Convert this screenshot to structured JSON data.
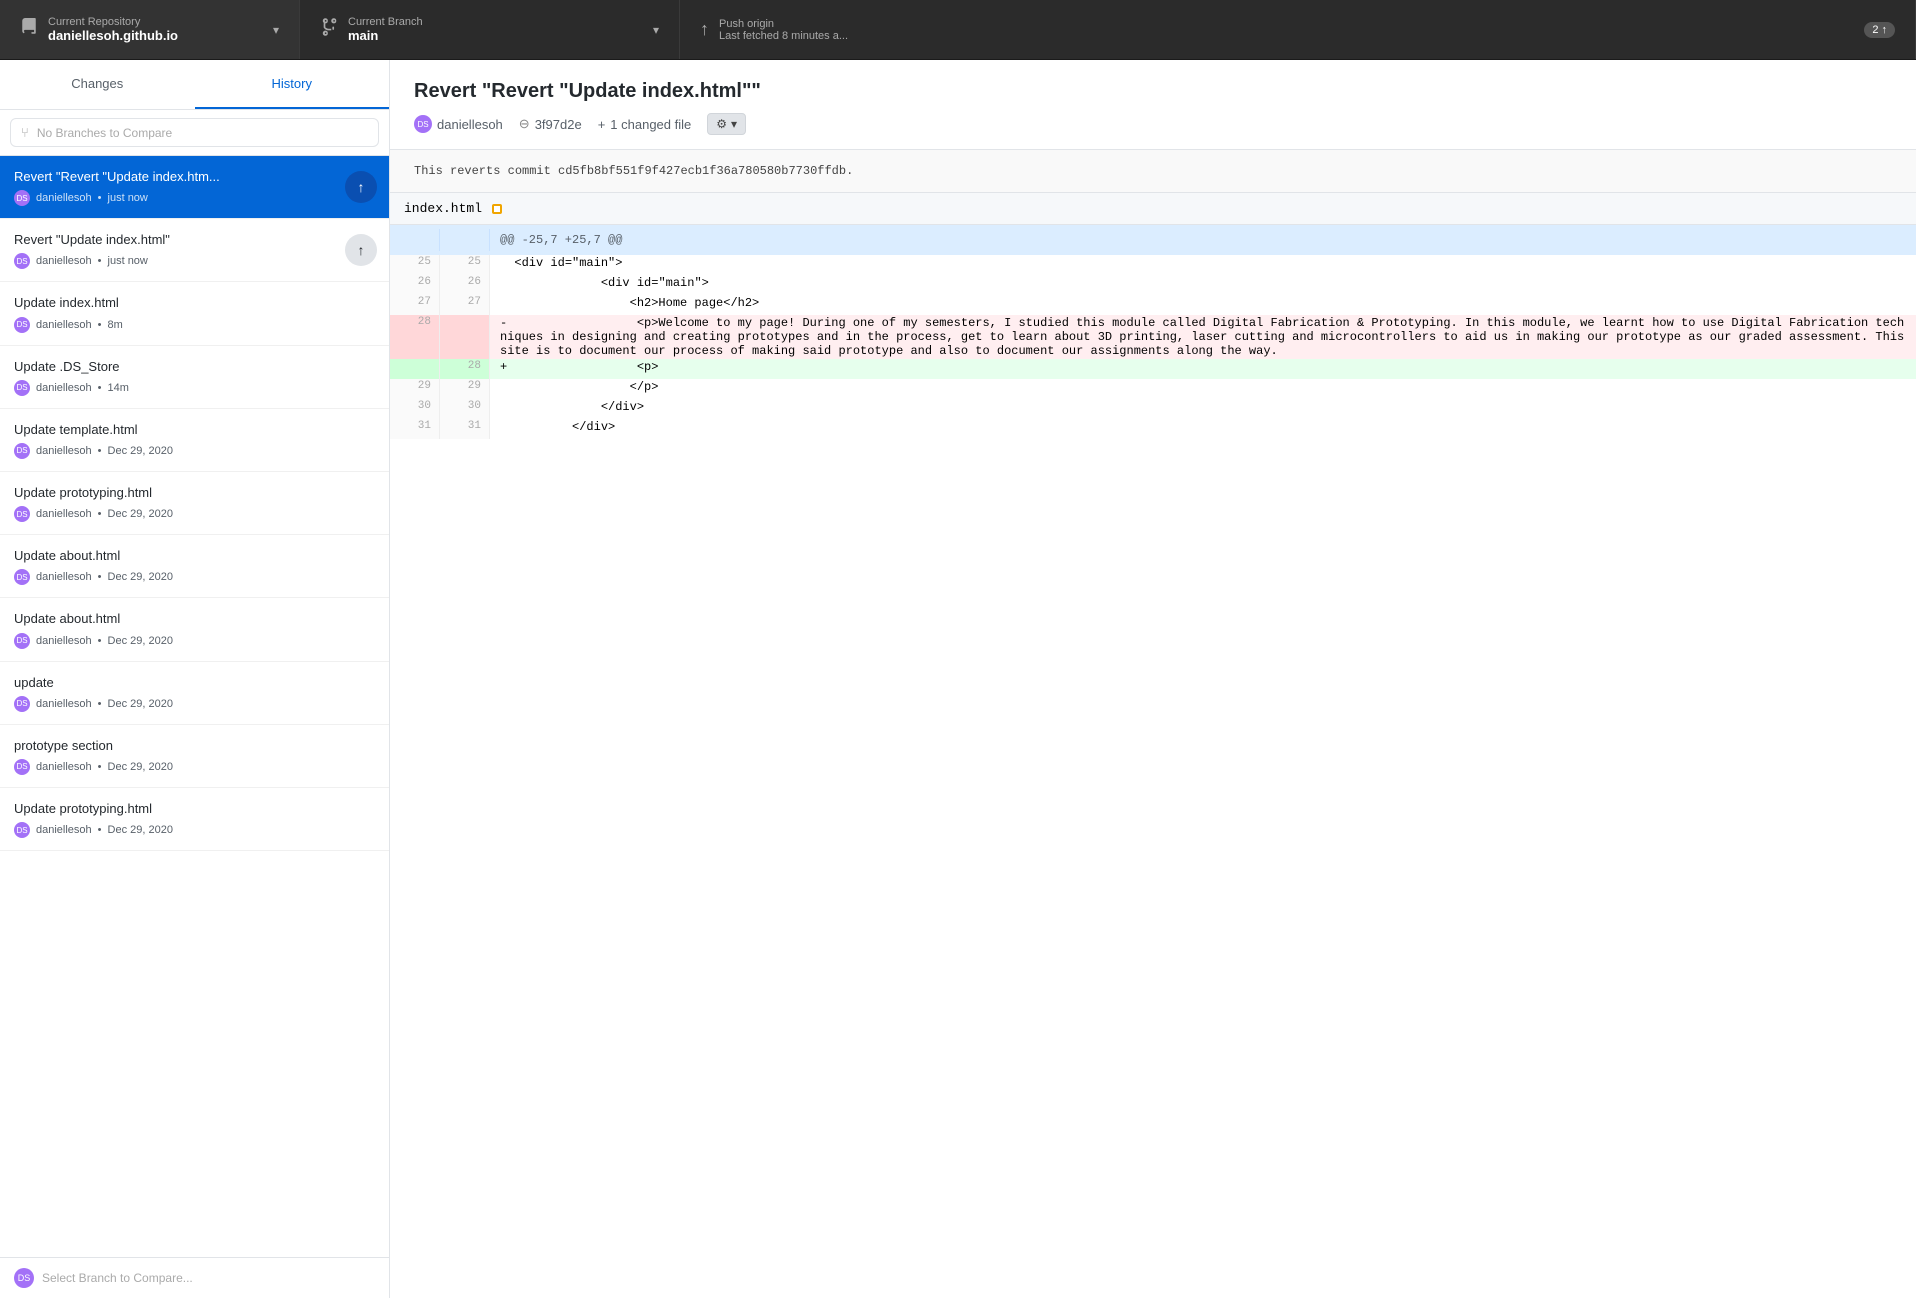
{
  "topbar": {
    "repo_label": "Current Repository",
    "repo_name": "daniellesoh.github.io",
    "branch_label": "Current Branch",
    "branch_name": "main",
    "push_label": "Push origin",
    "push_sub": "Last fetched 8 minutes a...",
    "push_count": "2",
    "push_arrow": "↑",
    "repo_icon": "⬜",
    "branch_icon": "⑂",
    "push_icon": "↑"
  },
  "sidebar": {
    "tab_changes": "Changes",
    "tab_history": "History",
    "branch_compare_placeholder": "No Branches to Compare",
    "commits": [
      {
        "title": "Revert \"Revert \"Update index.htm...",
        "author": "daniellesoh",
        "time": "just now",
        "show_push": true,
        "active": true,
        "push_highlight": true
      },
      {
        "title": "Revert \"Update index.html\"",
        "author": "daniellesoh",
        "time": "just now",
        "show_push": true,
        "active": false,
        "push_highlight": false
      },
      {
        "title": "Update index.html",
        "author": "daniellesoh",
        "time": "8m",
        "show_push": false,
        "active": false
      },
      {
        "title": "Update .DS_Store",
        "author": "daniellesoh",
        "time": "14m",
        "show_push": false,
        "active": false
      },
      {
        "title": "Update template.html",
        "author": "daniellesoh",
        "time": "Dec 29, 2020",
        "show_push": false,
        "active": false
      },
      {
        "title": "Update prototyping.html",
        "author": "daniellesoh",
        "time": "Dec 29, 2020",
        "show_push": false,
        "active": false
      },
      {
        "title": "Update about.html",
        "author": "daniellesoh",
        "time": "Dec 29, 2020",
        "show_push": false,
        "active": false
      },
      {
        "title": "Update about.html",
        "author": "daniellesoh",
        "time": "Dec 29, 2020",
        "show_push": false,
        "active": false
      },
      {
        "title": "update",
        "author": "daniellesoh",
        "time": "Dec 29, 2020",
        "show_push": false,
        "active": false
      },
      {
        "title": "prototype section",
        "author": "daniellesoh",
        "time": "Dec 29, 2020",
        "show_push": false,
        "active": false
      },
      {
        "title": "Update prototyping.html",
        "author": "daniellesoh",
        "time": "Dec 29, 2020",
        "show_push": false,
        "active": false
      }
    ],
    "bottom_label": "Select Branch to Compare..."
  },
  "content": {
    "commit_title": "Revert \"Revert \"Update index.html\"\"",
    "commit_description": "This reverts commit cd5fb8bf551f9f427ecb1f36a780580b7730ffdb.",
    "author": "daniellesoh",
    "hash": "3f97d2e",
    "changed_files": "1 changed file",
    "file_name": "index.html",
    "hunk_header": "@@ -25,7 +25,7 @@",
    "diff_lines": [
      {
        "old_num": "25",
        "new_num": "25",
        "type": "context",
        "sign": " ",
        "content": "                    <div id=\"main\">"
      },
      {
        "old_num": "26",
        "new_num": "26",
        "type": "context",
        "sign": " ",
        "content": "                    <div id=\"main\">"
      },
      {
        "old_num": "27",
        "new_num": "27",
        "type": "context",
        "sign": " ",
        "content": "                        <h2>Home page</h2>"
      },
      {
        "old_num": "28",
        "new_num": "",
        "type": "removed",
        "sign": "-",
        "content": "                        <p>Welcome to my page! During one of my semesters, I studied this module called Digital Fabrication & Prototyping. In this module, we learnt how to use Digital Fabrication techniques in designing and creating prototypes and in the process, get to learn about 3D printing, laser cutting and microcontrollers to aid us in making our prototype as our graded assessment. This site is to document our process of making said prototype and also to document our assignments along the way."
      },
      {
        "old_num": "",
        "new_num": "28",
        "type": "added",
        "sign": "+",
        "content": "                        <p>"
      },
      {
        "old_num": "29",
        "new_num": "29",
        "type": "context",
        "sign": " ",
        "content": "                        </p>"
      },
      {
        "old_num": "30",
        "new_num": "30",
        "type": "context",
        "sign": " ",
        "content": "                    </div>"
      },
      {
        "old_num": "31",
        "new_num": "31",
        "type": "context",
        "sign": " ",
        "content": "                </div>"
      }
    ]
  },
  "icons": {
    "branch": "⑂",
    "push": "↑",
    "commit": "◯",
    "gear": "⚙",
    "chevron_down": "▾",
    "chevron_right": "›",
    "plus": "+",
    "circle": "●",
    "avatar_text": "DS"
  }
}
